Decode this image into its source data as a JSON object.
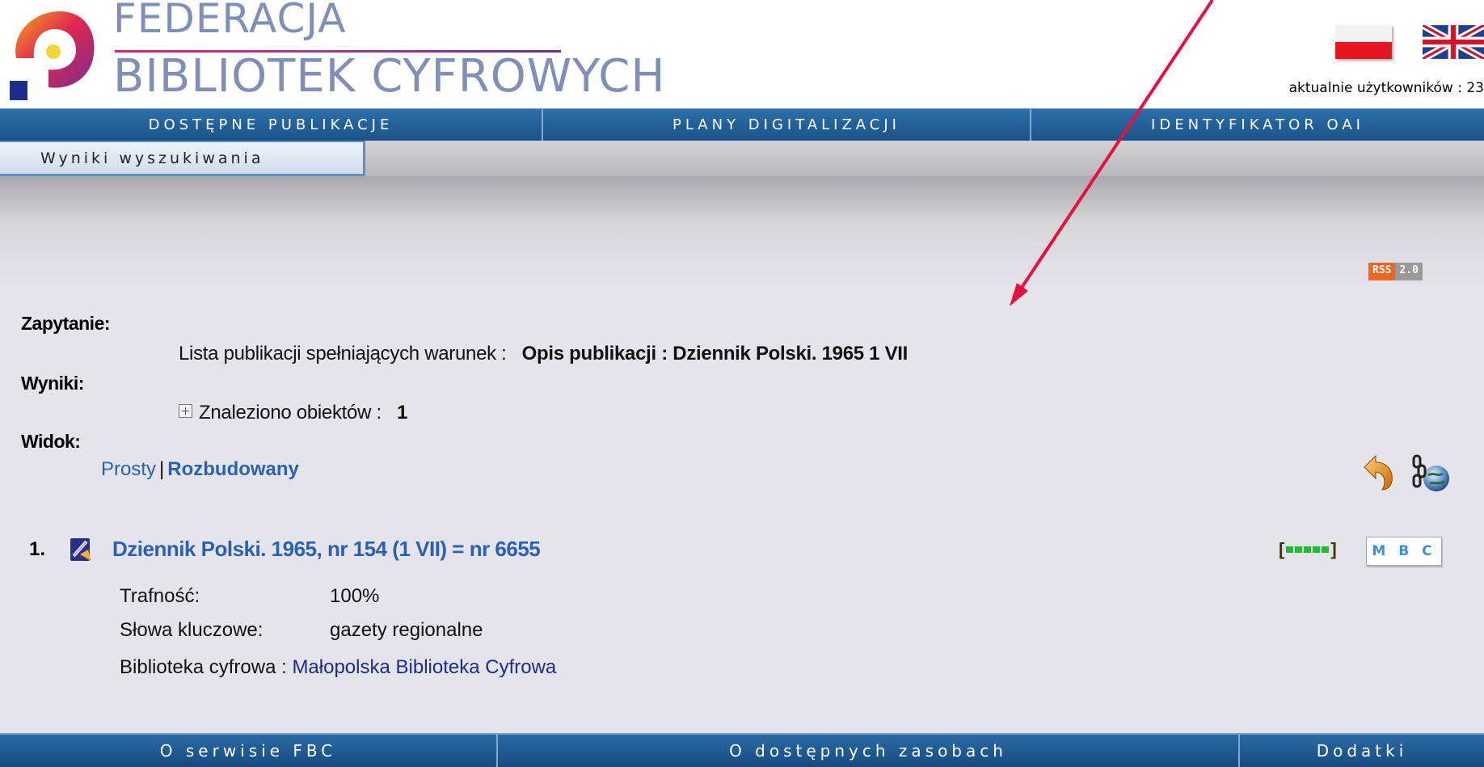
{
  "header": {
    "logo_line1": "FEDERACJA",
    "logo_line2": "BIBLIOTEK CYFROWYCH",
    "users_online": "aktualnie użytkowników : 23",
    "flags": [
      "poland-flag-icon",
      "uk-flag-icon"
    ]
  },
  "top_nav": {
    "tabs": [
      {
        "label": "DOSTĘPNE PUBLIKACJE"
      },
      {
        "label": "PLANY DIGITALIZACJI"
      },
      {
        "label": "IDENTYFIKATOR OAI"
      }
    ]
  },
  "sub_nav": {
    "active_tab": "Wyniki wyszukiwania"
  },
  "rss": {
    "left": "RSS",
    "right": "2.0"
  },
  "query": {
    "label": "Zapytanie:",
    "prefix": "Lista publikacji spełniających warunek :",
    "condition": "Opis publikacji : Dziennik Polski. 1965 1 VII"
  },
  "results": {
    "label": "Wyniki:",
    "found_label": "Znaleziono obiektów :",
    "found_count": "1"
  },
  "view": {
    "label": "Widok:",
    "simple": "Prosty",
    "separator": "|",
    "extended": "Rozbudowany"
  },
  "result_items": [
    {
      "number": "1.",
      "title": "Dziennik Polski. 1965, nr 154 (1 VII) = nr 6655",
      "relevance_open": "[",
      "relevance_close": "]",
      "relevance_level": 1.0,
      "library_badge": "M B C",
      "relevance_key": "Trafność:",
      "relevance_value": "100%",
      "keywords_key": "Słowa kluczowe:",
      "keywords_value": "gazety regionalne",
      "library_key": "Biblioteka cyfrowa :",
      "library_value": "Małopolska Biblioteka Cyfrowa"
    }
  ],
  "bottom_nav": {
    "tabs": [
      {
        "label": "O serwisie FBC"
      },
      {
        "label": "O dostępnych zasobach"
      },
      {
        "label": "Dodatki"
      }
    ]
  },
  "colors": {
    "nav_blue": "#1b5288",
    "link_blue": "#2a61b5",
    "annotation_arrow": "#e8103c",
    "relevance_green": "#1fc12a",
    "rss_orange": "#f26522"
  }
}
